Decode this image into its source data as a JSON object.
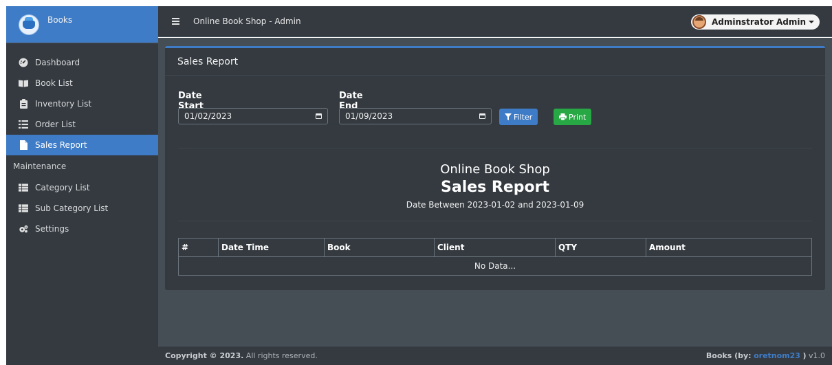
{
  "brand": {
    "name": "Books",
    "logo_icon": "bookshop-logo-icon"
  },
  "topbar": {
    "title": "Online Book Shop - Admin",
    "user_name": "Adminstrator Admin"
  },
  "sidebar": {
    "items": [
      {
        "label": "Dashboard",
        "icon": "tachometer-icon"
      },
      {
        "label": "Book List",
        "icon": "book-icon"
      },
      {
        "label": "Inventory List",
        "icon": "clipboard-icon"
      },
      {
        "label": "Order List",
        "icon": "list-icon"
      },
      {
        "label": "Sales Report",
        "icon": "file-icon",
        "active": true
      }
    ],
    "section_header": "Maintenance",
    "maintenance_items": [
      {
        "label": "Category List",
        "icon": "table-icon"
      },
      {
        "label": "Sub Category List",
        "icon": "table-icon"
      },
      {
        "label": "Settings",
        "icon": "cogs-icon"
      }
    ]
  },
  "card": {
    "title": "Sales Report",
    "date_start_label": "Date Start",
    "date_start_value": "01/02/2023",
    "date_end_label": "Date End",
    "date_end_value": "01/09/2023",
    "filter_button": "Filter",
    "print_button": "Print"
  },
  "report": {
    "shop_name": "Online Book Shop",
    "title": "Sales Report",
    "date_range": "Date Between 2023-01-02 and 2023-01-09",
    "columns": [
      "#",
      "Date Time",
      "Book",
      "Client",
      "QTY",
      "Amount"
    ],
    "empty_message": "No Data..."
  },
  "footer": {
    "copyright_bold": "Copyright © 2023.",
    "copyright_rest": "All rights reserved.",
    "credit_prefix": "Books (by:",
    "credit_author": "oretnom23",
    "credit_suffix": ")",
    "version": "v1.0"
  },
  "colors": {
    "primary": "#3f7cc7",
    "success": "#28a745",
    "dark": "#343a40",
    "content_bg": "#454d55"
  }
}
